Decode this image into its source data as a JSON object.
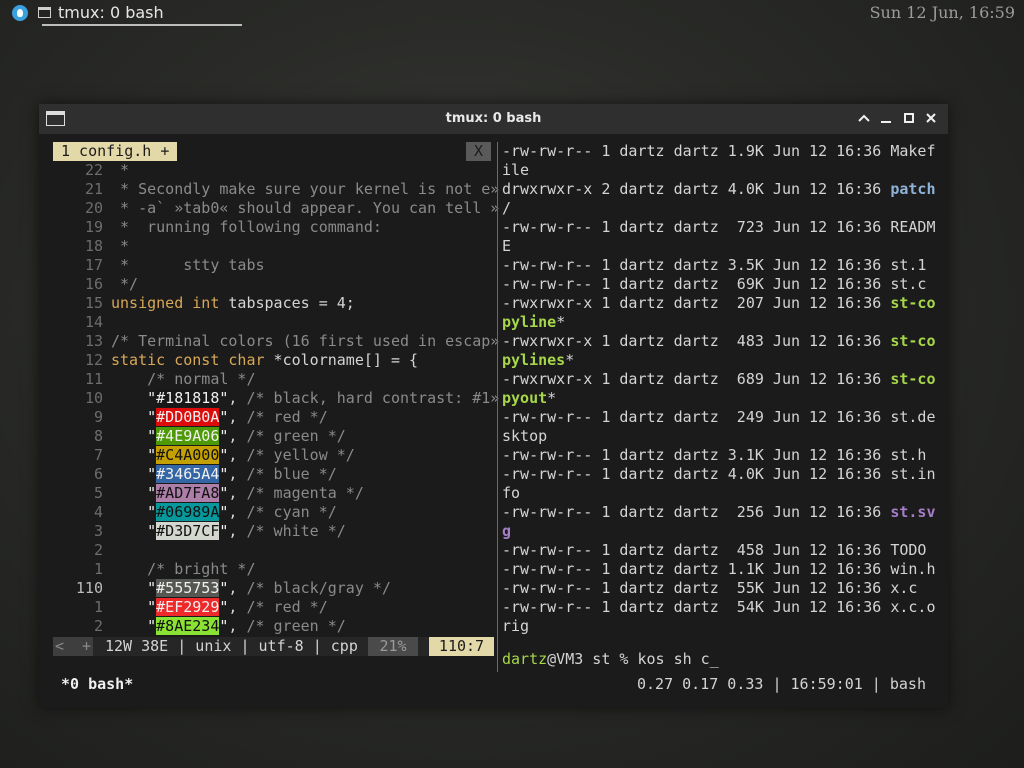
{
  "panel": {
    "task_title": "tmux: 0 bash",
    "clock": "Sun 12 Jun, 16:59"
  },
  "window": {
    "title": "tmux: 0 bash"
  },
  "vim": {
    "tab_label": "1 config.h +",
    "close_label": "X",
    "lines": [
      {
        "num": "22",
        "code": " *"
      },
      {
        "num": "21",
        "code": " * Secondly make sure your kernel is not e»"
      },
      {
        "num": "20",
        "code": " * -a` »tab0« should appear. You can tell »"
      },
      {
        "num": "19",
        "code": " *  running following command:"
      },
      {
        "num": "18",
        "code": " *"
      },
      {
        "num": "17",
        "code": " *      stty tabs"
      },
      {
        "num": "16",
        "code": " */"
      },
      {
        "num": "15",
        "code_type": "unsigned int",
        "code_rest": " tabspaces = 4;"
      },
      {
        "num": "14",
        "code": ""
      },
      {
        "num": "13",
        "code": "/* Terminal colors (16 first used in escap»"
      },
      {
        "num": "12",
        "code_type": "static const char",
        "code_rest": " *colorname[] = {"
      },
      {
        "num": "11",
        "code": "    /* normal */"
      },
      {
        "num": "10",
        "hex": "\"#181818\"",
        "rest": ", /* black, hard contrast: #1»"
      },
      {
        "num": "9",
        "hex": "\"#DD0B0A\"",
        "rest": ", /* red */"
      },
      {
        "num": "8",
        "hex": "\"#4E9A06\"",
        "rest": ", /* green */"
      },
      {
        "num": "7",
        "hex": "\"#C4A000\"",
        "rest": ", /* yellow */"
      },
      {
        "num": "6",
        "hex": "\"#3465A4\"",
        "rest": ", /* blue */"
      },
      {
        "num": "5",
        "hex": "\"#AD7FA8\"",
        "rest": ", /* magenta */"
      },
      {
        "num": "4",
        "hex": "\"#06989A\"",
        "rest": ", /* cyan */"
      },
      {
        "num": "3",
        "hex": "\"#D3D7CF\"",
        "rest": ", /* white */"
      },
      {
        "num": "2",
        "code": ""
      },
      {
        "num": "1",
        "code": "    /* bright */"
      },
      {
        "num": "110",
        "hex": "\"#555753\"",
        "rest": ", /* black/gray */"
      },
      {
        "num": "1",
        "hex": "\"#EF2929\"",
        "rest": ", /* red */"
      },
      {
        "num": "2",
        "hex": "\"#8AE234\"",
        "rest": ", /* green */"
      }
    ],
    "status": {
      "mode": "<  +",
      "info": "12W 38E | unix | utf-8 | cpp",
      "percent": "21%",
      "position": "110:7"
    }
  },
  "ls": {
    "lines": [
      {
        "meta": "-rw-rw-r-- 1 dartz dartz 1.9K Jun 12 16:36 ",
        "name": "Makef",
        "kind": "file"
      },
      {
        "meta": "",
        "name": "ile",
        "kind": "file"
      },
      {
        "meta": "drwxrwxr-x 2 dartz dartz 4.0K Jun 12 16:36 ",
        "name": "patch",
        "kind": "dir"
      },
      {
        "meta": "",
        "name": "/",
        "kind": "file"
      },
      {
        "meta": "-rw-rw-r-- 1 dartz dartz  723 Jun 12 16:36 ",
        "name": "READM",
        "kind": "file"
      },
      {
        "meta": "",
        "name": "E",
        "kind": "file"
      },
      {
        "meta": "-rw-rw-r-- 1 dartz dartz 3.5K Jun 12 16:36 ",
        "name": "st.1",
        "kind": "file"
      },
      {
        "meta": "-rw-rw-r-- 1 dartz dartz  69K Jun 12 16:36 ",
        "name": "st.c",
        "kind": "file"
      },
      {
        "meta": "-rwxrwxr-x 1 dartz dartz  207 Jun 12 16:36 ",
        "name": "st-co",
        "kind": "exe"
      },
      {
        "meta": "",
        "name": "pyline",
        "suffix": "*",
        "kind": "exe"
      },
      {
        "meta": "-rwxrwxr-x 1 dartz dartz  483 Jun 12 16:36 ",
        "name": "st-co",
        "kind": "exe"
      },
      {
        "meta": "",
        "name": "pylines",
        "suffix": "*",
        "kind": "exe"
      },
      {
        "meta": "-rwxrwxr-x 1 dartz dartz  689 Jun 12 16:36 ",
        "name": "st-co",
        "kind": "exe"
      },
      {
        "meta": "",
        "name": "pyout",
        "suffix": "*",
        "kind": "exe"
      },
      {
        "meta": "-rw-rw-r-- 1 dartz dartz  249 Jun 12 16:36 ",
        "name": "st.de",
        "kind": "file"
      },
      {
        "meta": "",
        "name": "sktop",
        "kind": "file"
      },
      {
        "meta": "-rw-rw-r-- 1 dartz dartz 3.1K Jun 12 16:36 ",
        "name": "st.h",
        "kind": "file"
      },
      {
        "meta": "-rw-rw-r-- 1 dartz dartz 4.0K Jun 12 16:36 ",
        "name": "st.in",
        "kind": "file"
      },
      {
        "meta": "",
        "name": "fo",
        "kind": "file"
      },
      {
        "meta": "-rw-rw-r-- 1 dartz dartz  256 Jun 12 16:36 ",
        "name": "st.sv",
        "kind": "img"
      },
      {
        "meta": "",
        "name": "g",
        "kind": "img"
      },
      {
        "meta": "-rw-rw-r-- 1 dartz dartz  458 Jun 12 16:36 ",
        "name": "TODO",
        "kind": "file"
      },
      {
        "meta": "-rw-rw-r-- 1 dartz dartz 1.1K Jun 12 16:36 ",
        "name": "win.h",
        "kind": "file"
      },
      {
        "meta": "-rw-rw-r-- 1 dartz dartz  55K Jun 12 16:36 ",
        "name": "x.c",
        "kind": "file"
      },
      {
        "meta": "-rw-rw-r-- 1 dartz dartz  54K Jun 12 16:36 ",
        "name": "x.c.o",
        "kind": "file"
      },
      {
        "meta": "",
        "name": "rig",
        "kind": "file"
      }
    ],
    "prompt": {
      "user": "dartz",
      "rest": "@VM3 st % kos sh c_"
    }
  },
  "tmux": {
    "window_label": "*0 bash*",
    "right_status": "0.27 0.17 0.33 | 16:59:01 | bash"
  },
  "colors": {
    "hex_backgrounds": [
      "#181818",
      "#DD0B0A",
      "#4E9A06",
      "#C4A000",
      "#3465A4",
      "#AD7FA8",
      "#06989A",
      "#D3D7CF",
      "#555753",
      "#EF2929",
      "#8AE234"
    ],
    "accent_green": "#a6d64a",
    "tab_yellow": "#e3d8a8"
  }
}
